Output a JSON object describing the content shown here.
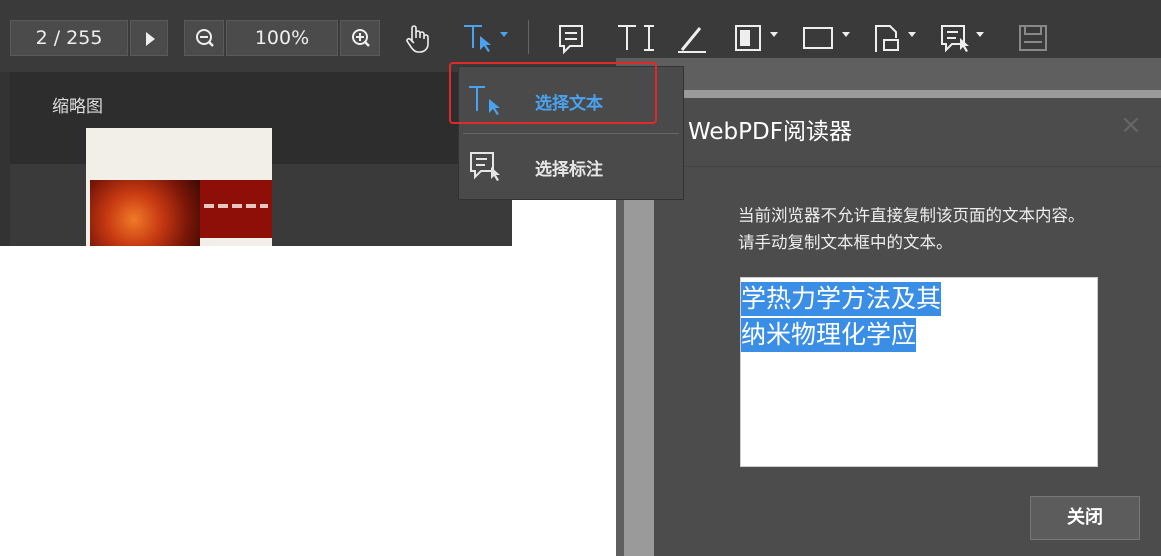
{
  "toolbar": {
    "page_indicator": "2 / 255",
    "zoom": "100%",
    "icons": [
      "next-page-icon",
      "zoom-out-icon",
      "zoom-in-icon",
      "hand-icon",
      "select-text-icon",
      "comment-icon",
      "text-tool-icon",
      "pen-icon",
      "layout-icon",
      "rectangle-icon",
      "attachment-icon",
      "select-annotation-icon",
      "save-icon"
    ]
  },
  "sidebar": {
    "title": "缩略图"
  },
  "dropdown": {
    "items": [
      {
        "label": "选择文本",
        "icon": "select-text-icon",
        "color": "#4aa3f0"
      },
      {
        "label": "选择标注",
        "icon": "select-annotation-icon",
        "color": "#e6e6e6"
      }
    ]
  },
  "dialog": {
    "title": "WebPDF阅读器",
    "message": "当前浏览器不允许直接复制该页面的文本内容。请手动复制文本框中的文本。",
    "text_lines": [
      "学热力学方法及其",
      "纳米物理化学应"
    ],
    "close_label": "关闭"
  },
  "colors": {
    "accent": "#4aa3f0",
    "highlight_border": "#e02a2a",
    "selection": "#3a8ee6"
  }
}
